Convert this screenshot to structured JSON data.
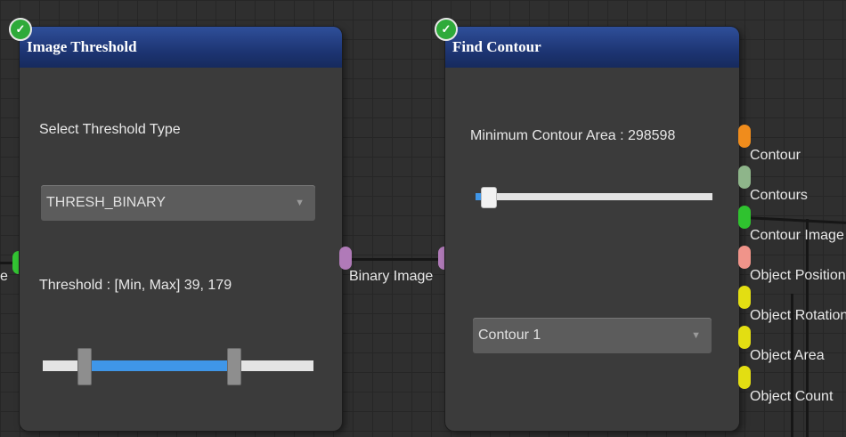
{
  "nodes": {
    "threshold": {
      "title": "Image Threshold",
      "select_label": "Select Threshold Type",
      "dropdown_value": "THRESH_BINARY",
      "threshold_label": "Threshold : [Min, Max] 39, 179",
      "output_label": "Binary Image"
    },
    "contour": {
      "title": "Find Contour",
      "min_area_label": "Minimum Contour Area : 298598",
      "dropdown_value": "Contour 1",
      "outputs": [
        {
          "label": "Contour",
          "color": "#f08c1c"
        },
        {
          "label": "Contours",
          "color": "#8eb58a"
        },
        {
          "label": "Contour Image",
          "color": "#2fc22f"
        },
        {
          "label": "Object Position",
          "color": "#f0948a"
        },
        {
          "label": "Object Rotation",
          "color": "#e3de12"
        },
        {
          "label": "Object Area",
          "color": "#e3de12"
        },
        {
          "label": "Object Count",
          "color": "#e3de12"
        }
      ]
    }
  },
  "left_edge_label": "e",
  "port_colors": {
    "green": "#33c533",
    "purple": "#b07ab8"
  },
  "slider": {
    "threshold_min_fraction": 0.153,
    "threshold_max_fraction": 0.702,
    "min_area_fraction": 0.0
  }
}
